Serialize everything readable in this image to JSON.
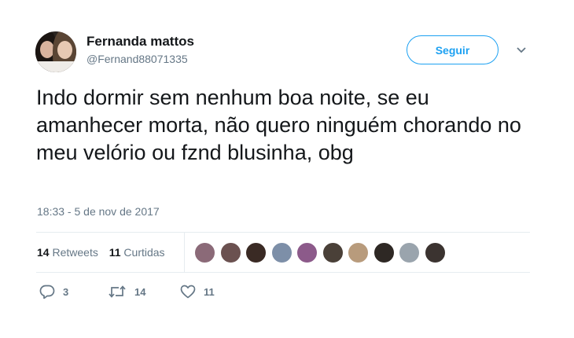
{
  "user": {
    "name": "Fernanda mattos",
    "handle": "@Fernand88071335"
  },
  "follow_label": "Seguir",
  "tweet": {
    "text": "Indo dormir sem nenhum boa noite, se eu amanhecer morta, não quero ninguém chorando no meu velório ou fznd blusinha, obg",
    "timestamp": "18:33 - 5 de nov de 2017"
  },
  "stats": {
    "retweets_count": "14",
    "retweets_label": "Retweets",
    "likes_count": "11",
    "likes_label": "Curtidas"
  },
  "liker_avatars": [
    "#8b6a78",
    "#6b5150",
    "#3a2a24",
    "#7d8fa8",
    "#8c5a8a",
    "#4a4038",
    "#b89b7c",
    "#2e2824",
    "#9aa4ad",
    "#3b3330"
  ],
  "actions": {
    "reply_count": "3",
    "retweet_count": "14",
    "like_count": "11"
  },
  "colors": {
    "accent": "#1da1f2",
    "secondary_text": "#657786"
  }
}
